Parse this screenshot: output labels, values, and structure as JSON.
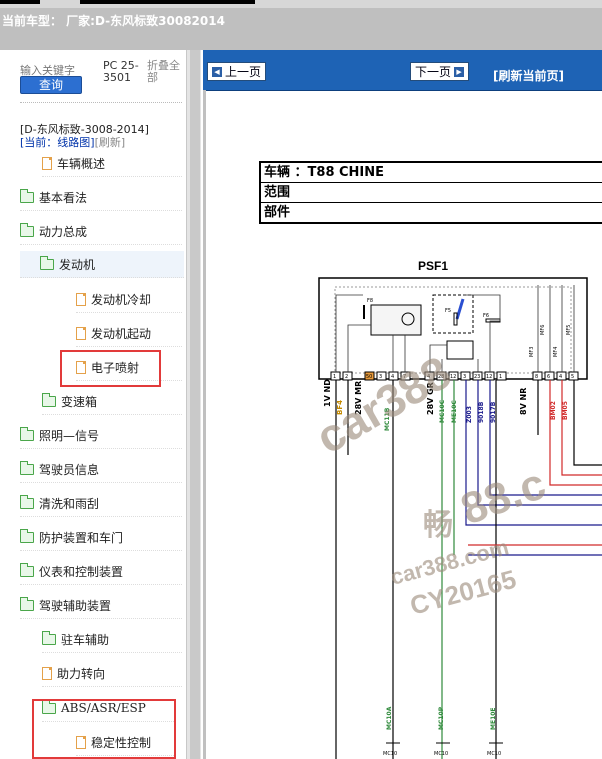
{
  "header": {
    "title": "当前车型：  厂家:D-东风标致30082014"
  },
  "sidebar": {
    "search_label": "输入关键字",
    "search_input_value": "",
    "query_button": "查询",
    "pc_label": "PC 25-3501",
    "fold_all": "折叠全部",
    "model_title": "[D-东风标致-3008-2014]",
    "current_prefix": "[当前：线路图]",
    "refresh_link": "[刷新]",
    "tree": [
      {
        "label": "车辆概述",
        "type": "doc"
      },
      {
        "label": "基本看法",
        "type": "folder"
      },
      {
        "label": "动力总成",
        "type": "folder"
      },
      {
        "label": "发动机",
        "type": "folder"
      },
      {
        "label": "发动机冷却",
        "type": "doc"
      },
      {
        "label": "发动机起动",
        "type": "doc"
      },
      {
        "label": "电子喷射",
        "type": "doc"
      },
      {
        "label": "变速箱",
        "type": "folder"
      },
      {
        "label": "照明—信号",
        "type": "folder"
      },
      {
        "label": "驾驶员信息",
        "type": "folder"
      },
      {
        "label": "清洗和雨刮",
        "type": "folder"
      },
      {
        "label": "防护装置和车门",
        "type": "folder"
      },
      {
        "label": "仪表和控制装置",
        "type": "folder"
      },
      {
        "label": "驾驶辅助装置",
        "type": "folder"
      },
      {
        "label": "驻车辅助",
        "type": "folder"
      },
      {
        "label": "助力转向",
        "type": "doc"
      },
      {
        "label": "ABS/ASR/ESP",
        "type": "folder"
      },
      {
        "label": "稳定性控制",
        "type": "doc"
      }
    ]
  },
  "main": {
    "prev_page": "上一页",
    "next_page": "下一页",
    "refresh_page": "[刷新当前页]",
    "info": {
      "vehicle": "车辆 ：T88 CHINE",
      "range": "范围",
      "part": "部件"
    },
    "diagram": {
      "title": "PSF1",
      "fuses": [
        "F8",
        "F5",
        "F6",
        "MF6",
        "MF5",
        "MF3",
        "MF4"
      ],
      "pins": [
        "1",
        "2",
        "50",
        "3",
        "4",
        "7",
        "4",
        "28",
        "12",
        "3",
        "23",
        "12",
        "1",
        "8",
        "6",
        "4",
        "5"
      ],
      "wire_labels": [
        "1V ND",
        "BF4",
        "28V MR",
        "MC11B",
        "28V GR",
        "MC10C",
        "ME10C",
        "Z003",
        "9018B",
        "9017B",
        "8V NR",
        "BM02",
        "BM05"
      ],
      "bottom_labels": [
        "MC10A",
        "MC10P",
        "ME10E"
      ],
      "ground_labels": [
        "MC10",
        "MC10",
        "MC10"
      ],
      "watermark": [
        "car388",
        "畅",
        "88.c",
        "car388.com",
        "CY20165"
      ]
    }
  },
  "colors": {
    "nav_bar": "#1e63b5",
    "header_bar": "#bfbfbf",
    "highlight_red": "#e23a3a",
    "folder_green": "#4aa64a",
    "doc_orange": "#e4a14a",
    "wire_blue": "#1a1a8c",
    "wire_red": "#d12a2a",
    "wire_green": "#2f8a3b"
  }
}
